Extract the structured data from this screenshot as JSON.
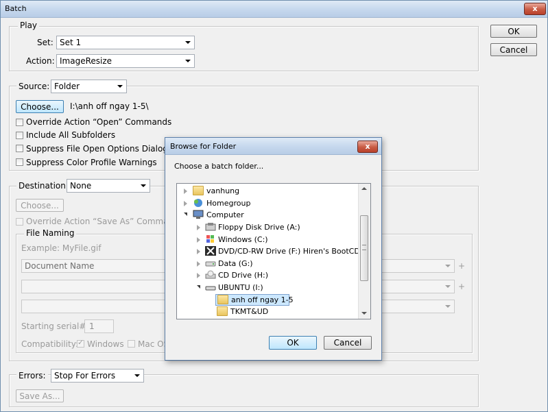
{
  "window": {
    "title": "Batch",
    "close_label": "x"
  },
  "buttons": {
    "ok": "OK",
    "cancel": "Cancel"
  },
  "play": {
    "legend": "Play",
    "set_label": "Set:",
    "set_value": "Set 1",
    "action_label": "Action:",
    "action_value": "ImageResize"
  },
  "source": {
    "label": "Source:",
    "value": "Folder",
    "choose_label": "Choose...",
    "path": "I:\\anh off ngay 1-5\\",
    "options": [
      "Override Action “Open” Commands",
      "Include All Subfolders",
      "Suppress File Open Options Dialogs",
      "Suppress Color Profile Warnings"
    ]
  },
  "destination": {
    "label": "Destination:",
    "value": "None",
    "choose_label": "Choose...",
    "override_label": "Override Action “Save As” Commands",
    "file_naming": {
      "legend": "File Naming",
      "example": "Example: MyFile.gif",
      "fields": [
        "Document Name",
        "",
        ""
      ],
      "serial_label": "Starting serial#:",
      "serial_value": "1",
      "compat_label": "Compatibility:",
      "windows_label": "Windows",
      "mac_label": "Mac OS"
    }
  },
  "errors": {
    "label": "Errors:",
    "value": "Stop For Errors",
    "save_as_label": "Save As..."
  },
  "browse": {
    "title": "Browse for Folder",
    "close_label": "x",
    "prompt": "Choose a batch folder...",
    "tree": [
      "vanhung",
      "Homegroup",
      "Computer",
      "Floppy Disk Drive (A:)",
      "Windows (C:)",
      "DVD/CD-RW Drive (F:) Hiren's BootCD",
      "Data (G:)",
      "CD Drive (H:)",
      "UBUNTU (I:)",
      "anh off ngay 1-5",
      "TKMT&UD"
    ],
    "ok": "OK",
    "cancel": "Cancel"
  },
  "colors": {
    "selection": "#cce8ff",
    "selection_border": "#7da2ce",
    "title_gradient_top": "#dfeaf6",
    "close_red": "#c85a43"
  }
}
